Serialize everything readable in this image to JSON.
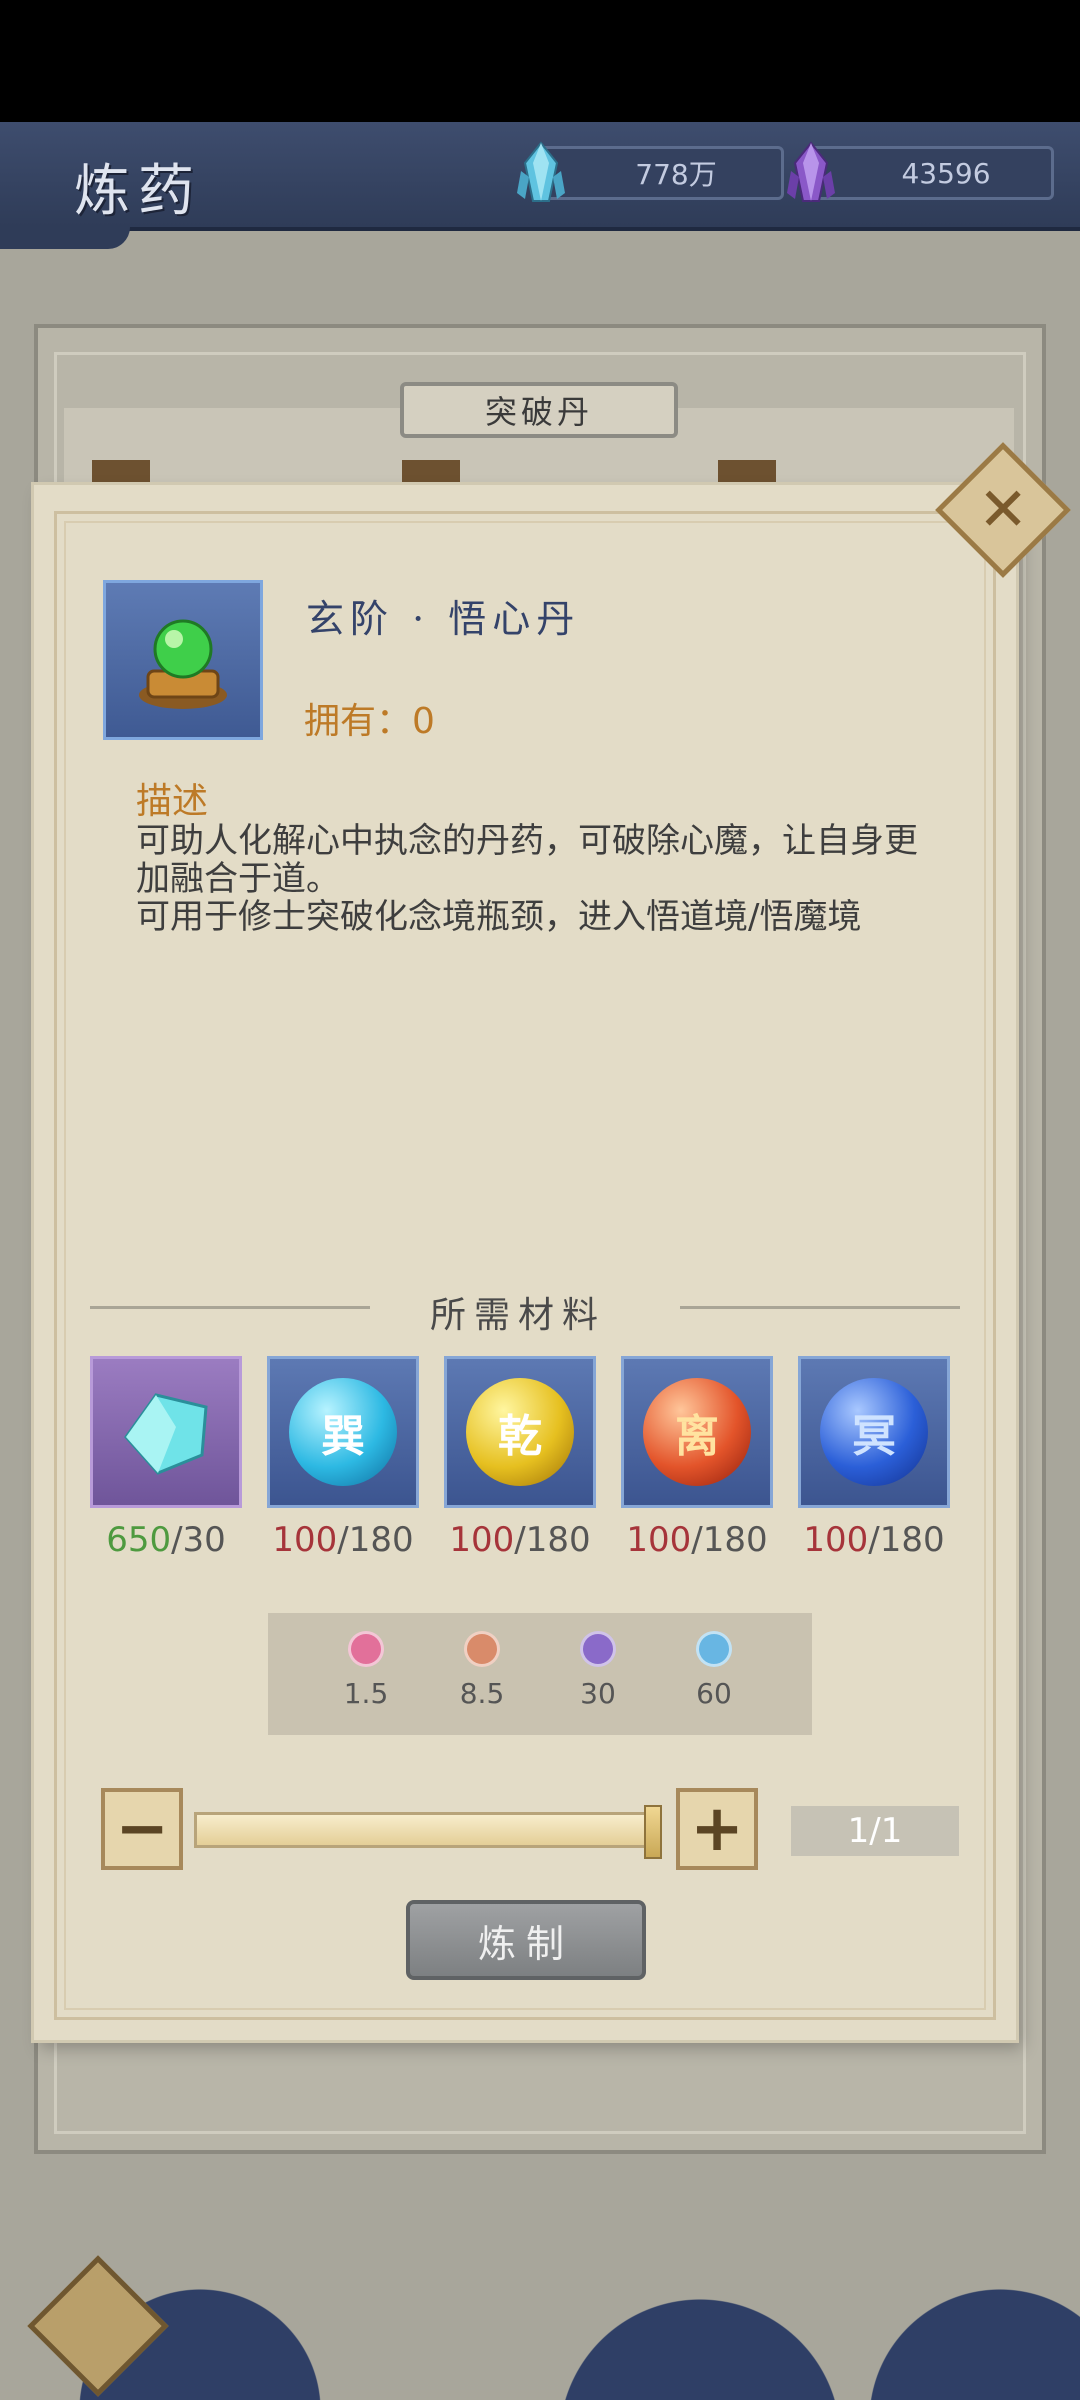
{
  "header": {
    "title": "炼药",
    "currencies": [
      {
        "icon": "blue-crystal-icon",
        "value": "778万"
      },
      {
        "icon": "purple-crystal-icon",
        "value": "43596"
      }
    ]
  },
  "tab": {
    "label": "突破丹"
  },
  "item": {
    "name": "玄阶 · 悟心丹",
    "owned": "拥有：0",
    "desc_title": "描述",
    "desc_lines": [
      "可助人化解心中执念的丹药，可破除心魔，让自身更加融合于道。",
      "可用于修士突破化念境瓶颈，进入悟道境/悟魔境"
    ]
  },
  "materials": {
    "title": "所需材料",
    "items": [
      {
        "icon": "cyan-crystal-icon",
        "glyph": "",
        "have": "650",
        "need": "/30",
        "enough": true
      },
      {
        "icon": "xun-orb-icon",
        "glyph": "巽",
        "have": "100",
        "need": "/180",
        "enough": false
      },
      {
        "icon": "qian-orb-icon",
        "glyph": "乾",
        "have": "100",
        "need": "/180",
        "enough": false
      },
      {
        "icon": "li-orb-icon",
        "glyph": "离",
        "have": "100",
        "need": "/180",
        "enough": false
      },
      {
        "icon": "kan-orb-icon",
        "glyph": "冥",
        "have": "100",
        "need": "/180",
        "enough": false
      }
    ]
  },
  "quality": [
    {
      "color": "#e2709a",
      "value": "1.5"
    },
    {
      "color": "#d98b6a",
      "value": "8.5"
    },
    {
      "color": "#8a6ac9",
      "value": "30"
    },
    {
      "color": "#68b6e3",
      "value": "60"
    }
  ],
  "quantity": {
    "minus": "−",
    "plus": "+",
    "count": "1/1",
    "fill": 1.0
  },
  "craft": {
    "label": "炼制"
  },
  "colors": {
    "orb_xun": "#2db9e3",
    "orb_qian": "#e6c020",
    "orb_li": "#e3542a",
    "orb_kan": "#2b5fd8"
  }
}
